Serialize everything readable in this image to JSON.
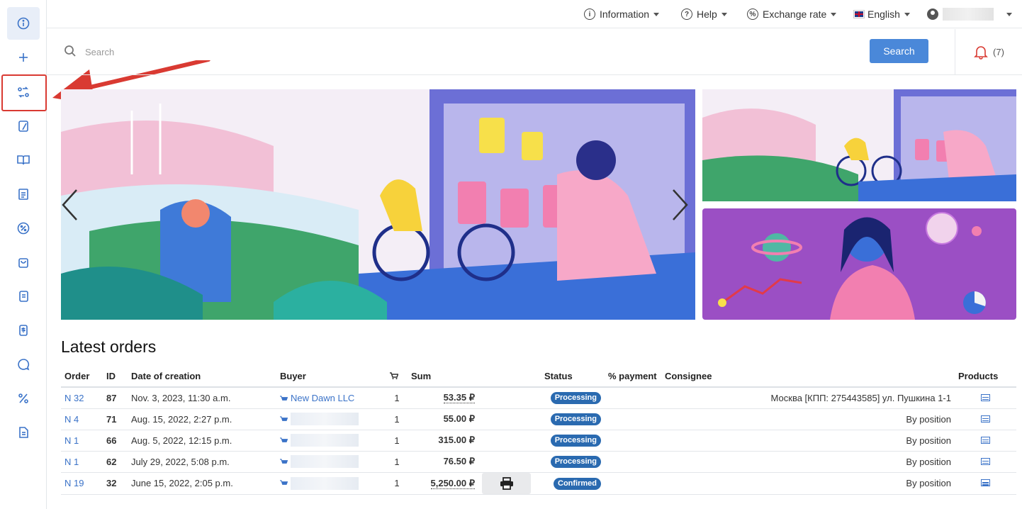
{
  "topbar": {
    "information": "Information",
    "help": "Help",
    "exchange_rate": "Exchange rate",
    "language": "English"
  },
  "search": {
    "placeholder": "Search",
    "button_label": "Search"
  },
  "notifications": {
    "count": "(7)"
  },
  "sidebar": {
    "items": [
      {
        "icon": "info-icon"
      },
      {
        "icon": "plus-icon"
      },
      {
        "icon": "exchange-icon"
      },
      {
        "icon": "catalog-icon"
      },
      {
        "icon": "book-icon"
      },
      {
        "icon": "report-icon"
      },
      {
        "icon": "percent-circle-icon"
      },
      {
        "icon": "bag-icon"
      },
      {
        "icon": "document-icon"
      },
      {
        "icon": "invoice-icon"
      },
      {
        "icon": "chat-icon"
      },
      {
        "icon": "percent-icon"
      },
      {
        "icon": "file-icon"
      }
    ]
  },
  "orders": {
    "title": "Latest orders",
    "columns": {
      "order": "Order",
      "id": "ID",
      "date": "Date of creation",
      "buyer": "Buyer",
      "sum": "Sum",
      "status": "Status",
      "payment": "% payment",
      "consignee": "Consignee",
      "products": "Products"
    },
    "rows": [
      {
        "order": "N 32",
        "id": "87",
        "date": "Nov. 3, 2023, 11:30 a.m.",
        "buyer": "New Dawn LLC",
        "qty": "1",
        "sum": "53.35 ₽",
        "status": "Processing",
        "consignee": "Москва [КПП: 275443585] ул. Пушкина 1-1"
      },
      {
        "order": "N 4",
        "id": "71",
        "date": "Aug. 15, 2022, 2:27 p.m.",
        "buyer": "",
        "qty": "1",
        "sum": "55.00 ₽",
        "status": "Processing",
        "consignee": "By position"
      },
      {
        "order": "N 1",
        "id": "66",
        "date": "Aug. 5, 2022, 12:15 p.m.",
        "buyer": "",
        "qty": "1",
        "sum": "315.00 ₽",
        "status": "Processing",
        "consignee": "By position"
      },
      {
        "order": "N 1",
        "id": "62",
        "date": "July 29, 2022, 5:08 p.m.",
        "buyer": "",
        "qty": "1",
        "sum": "76.50 ₽",
        "status": "Processing",
        "consignee": "By position"
      },
      {
        "order": "N 19",
        "id": "32",
        "date": "June 15, 2022, 2:05 p.m.",
        "buyer": "",
        "qty": "1",
        "sum": "5,250.00 ₽",
        "status": "Confirmed",
        "consignee": "By position"
      }
    ]
  },
  "colors": {
    "accent": "#3b73c8",
    "button": "#4a88d9",
    "badge": "#2a6ab0",
    "highlight": "#d93a32"
  }
}
